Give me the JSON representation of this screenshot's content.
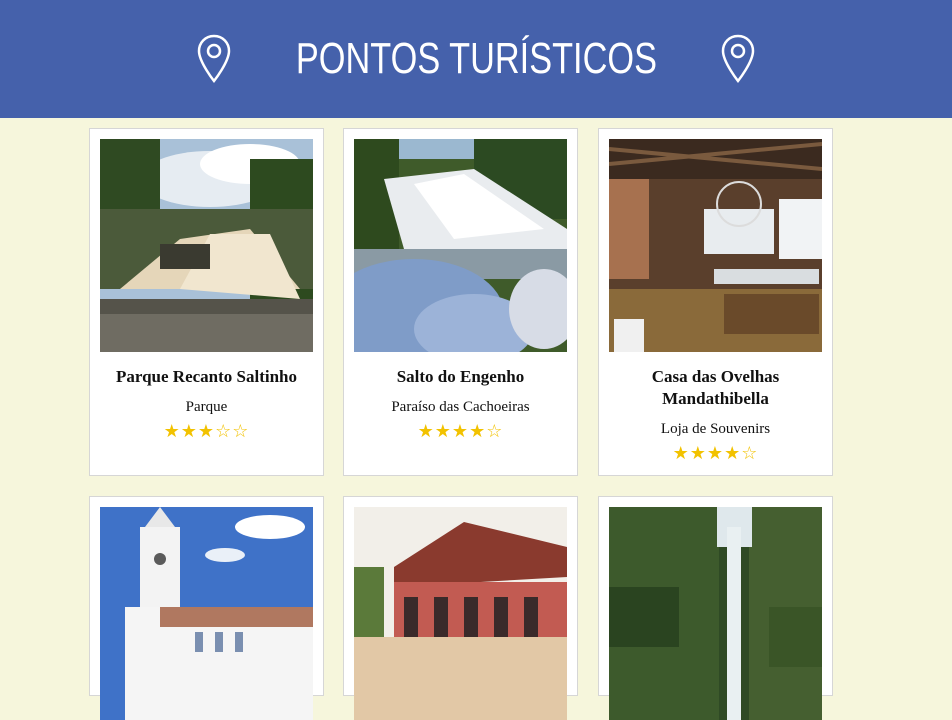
{
  "header": {
    "title": "PONTOS TURÍSTICOS",
    "bg_color": "#4561ab"
  },
  "cards": [
    {
      "name": "Parque Recanto Saltinho",
      "category": "Parque",
      "rating": 3,
      "stars": "★★★☆☆"
    },
    {
      "name": "Salto do Engenho",
      "category": "Paraíso das Cachoeiras",
      "rating": 4,
      "stars": "★★★★☆"
    },
    {
      "name": "Casa das Ovelhas Mandathibella",
      "category": "Loja de Souvenirs",
      "rating": 4,
      "stars": "★★★★☆"
    },
    {
      "name": "",
      "category": "",
      "stars": ""
    },
    {
      "name": "",
      "category": "",
      "stars": ""
    },
    {
      "name": "",
      "category": "",
      "stars": ""
    }
  ],
  "colors": {
    "page_bg": "#f6f6dc",
    "star": "#f2c200"
  }
}
